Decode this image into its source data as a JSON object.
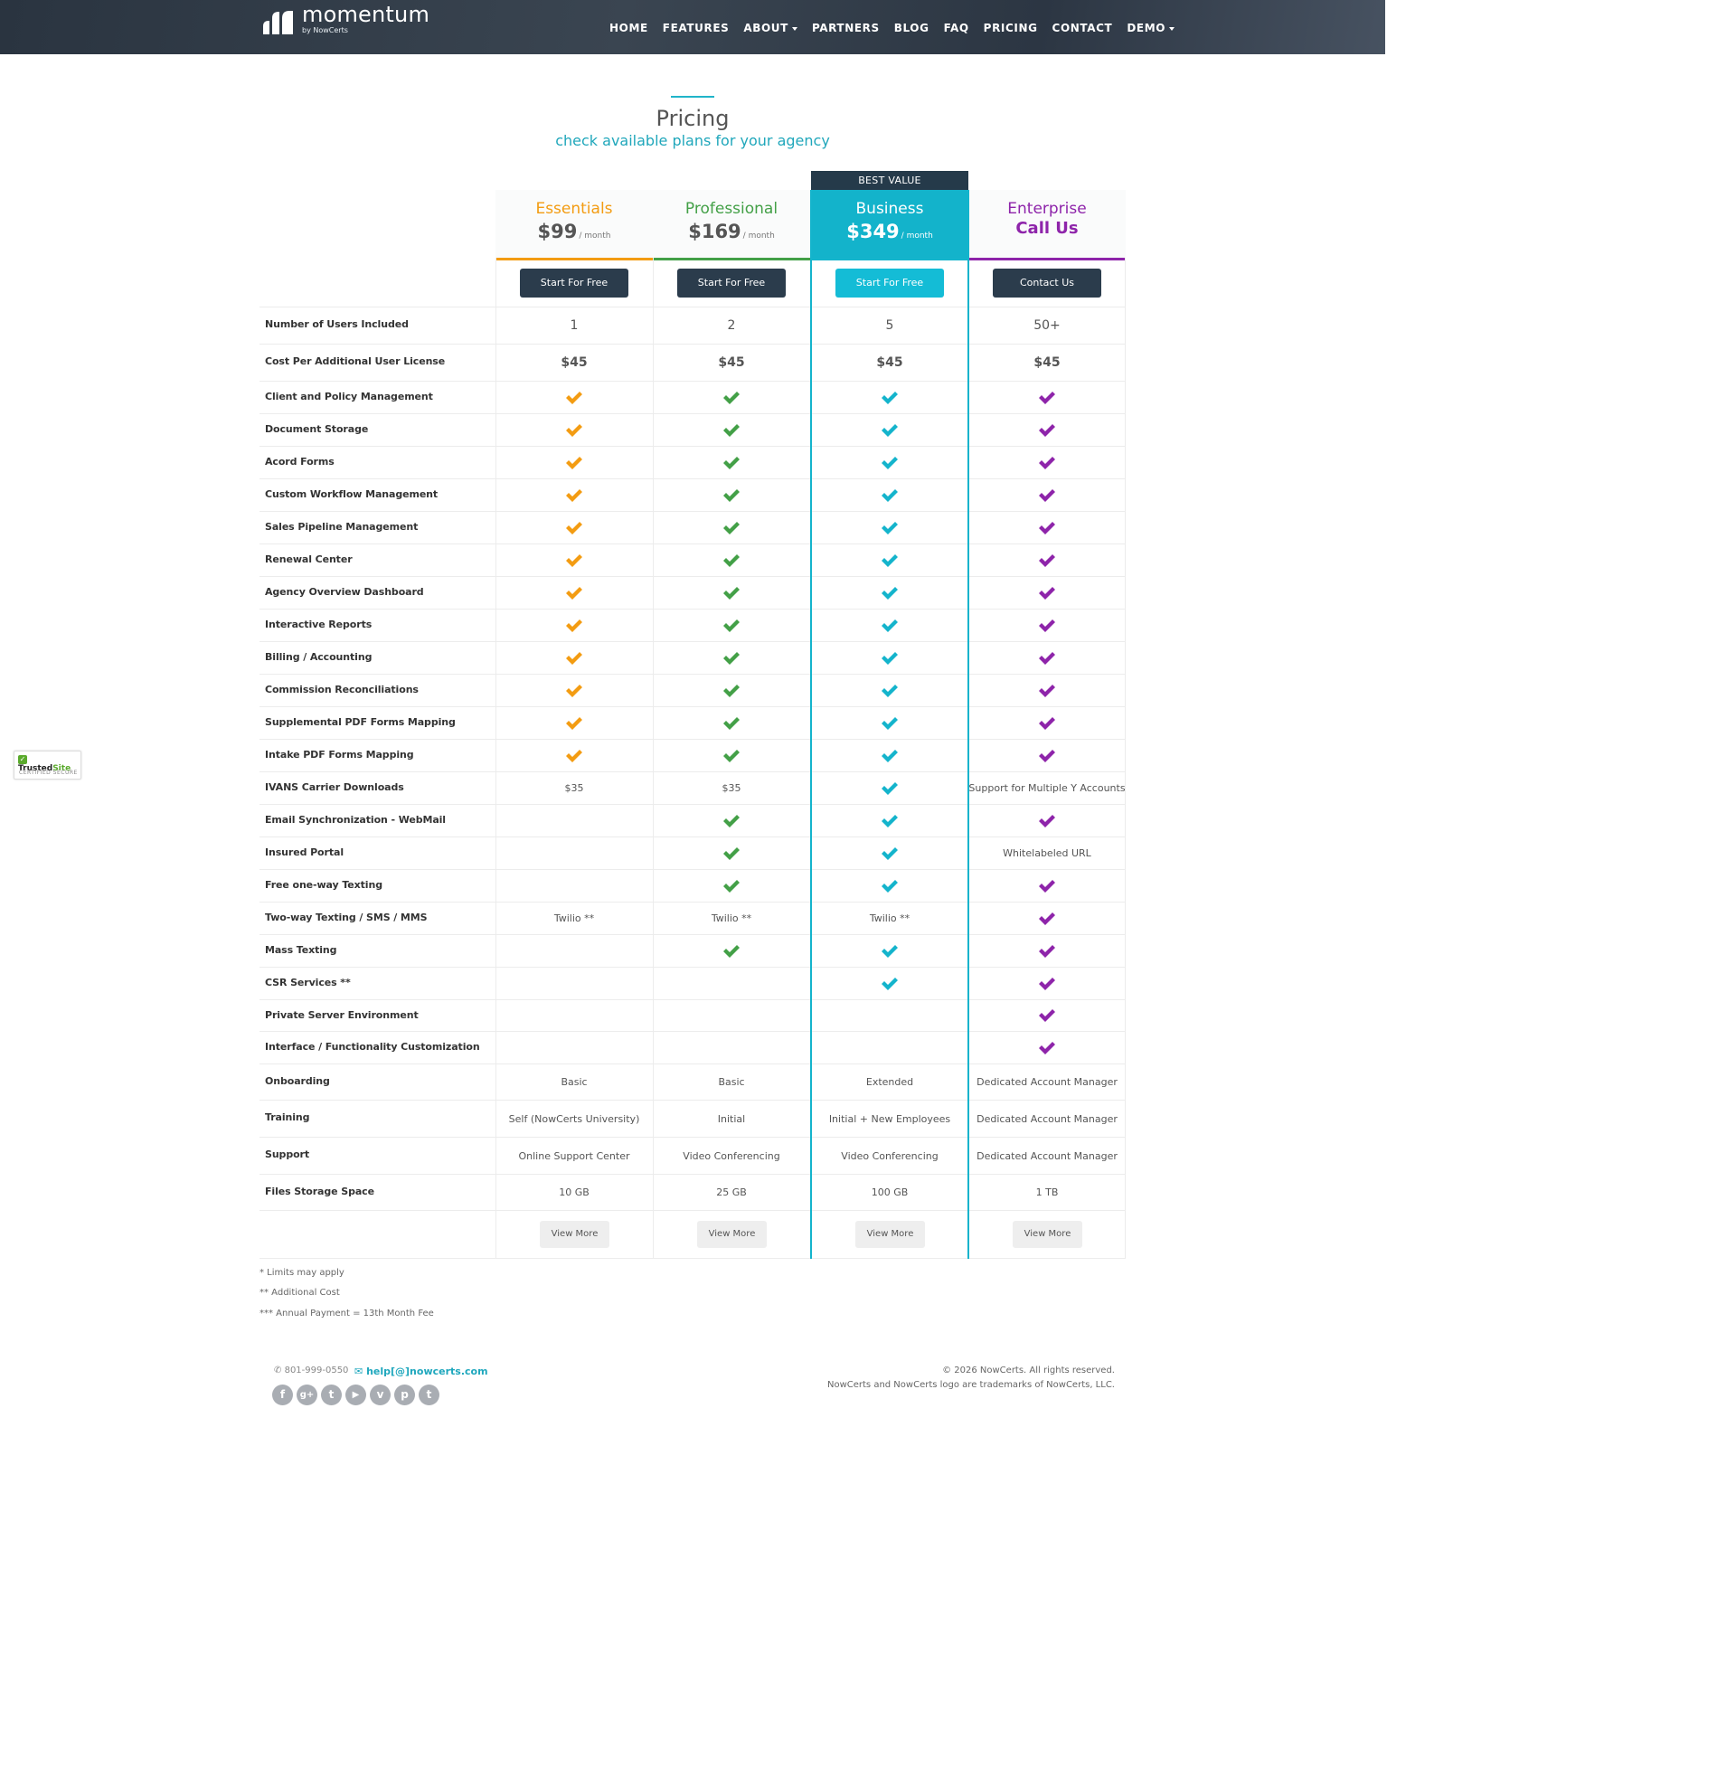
{
  "header": {
    "logo_text": "momentum",
    "logo_sub": "by NowCerts",
    "nav": [
      "HOME",
      "FEATURES",
      "ABOUT",
      "PARTNERS",
      "BLOG",
      "FAQ",
      "PRICING",
      "CONTACT",
      "DEMO"
    ]
  },
  "page": {
    "title": "Pricing",
    "subtitle": "check available plans for your agency"
  },
  "colors": {
    "essentials": "#f39c12",
    "professional": "#43a047",
    "business": "#14b4cc",
    "enterprise": "#8e24aa"
  },
  "plans": [
    {
      "name": "Essentials",
      "price": "$99",
      "per": "/ month",
      "button": "Start For Free"
    },
    {
      "name": "Professional",
      "price": "$169",
      "per": "/ month",
      "button": "Start For Free"
    },
    {
      "name": "Business",
      "price": "$349",
      "per": "/ month",
      "button": "Start For Free",
      "badge": "BEST VALUE"
    },
    {
      "name": "Enterprise",
      "price": "Call Us",
      "per": "",
      "button": "Contact Us"
    }
  ],
  "features": [
    {
      "label": "Number of Users Included",
      "values": [
        "1",
        "2",
        "5",
        "50+"
      ]
    },
    {
      "label": "Cost Per Additional User License",
      "values": [
        "$45",
        "$45",
        "$45",
        "$45"
      ]
    },
    {
      "label": "Client and Policy Management",
      "values": [
        "check",
        "check",
        "check",
        "check"
      ]
    },
    {
      "label": "Document Storage",
      "values": [
        "check",
        "check",
        "check",
        "check"
      ]
    },
    {
      "label": "Acord Forms",
      "values": [
        "check",
        "check",
        "check",
        "check"
      ]
    },
    {
      "label": "Custom Workflow Management",
      "values": [
        "check",
        "check",
        "check",
        "check"
      ]
    },
    {
      "label": "Sales Pipeline Management",
      "values": [
        "check",
        "check",
        "check",
        "check"
      ]
    },
    {
      "label": "Renewal Center",
      "values": [
        "check",
        "check",
        "check",
        "check"
      ]
    },
    {
      "label": "Agency Overview Dashboard",
      "values": [
        "check",
        "check",
        "check",
        "check"
      ]
    },
    {
      "label": "Interactive Reports",
      "values": [
        "check",
        "check",
        "check",
        "check"
      ]
    },
    {
      "label": "Billing / Accounting",
      "values": [
        "check",
        "check",
        "check",
        "check"
      ]
    },
    {
      "label": "Commission Reconciliations",
      "values": [
        "check",
        "check",
        "check",
        "check"
      ]
    },
    {
      "label": "Supplemental PDF Forms Mapping",
      "values": [
        "check",
        "check",
        "check",
        "check"
      ]
    },
    {
      "label": "Intake PDF Forms Mapping",
      "values": [
        "check",
        "check",
        "check",
        "check"
      ]
    },
    {
      "label": "IVANS Carrier Downloads",
      "values": [
        "$35",
        "$35",
        "check",
        "Support for Multiple Y Accounts"
      ]
    },
    {
      "label": "Email Synchronization - WebMail",
      "values": [
        "",
        "check",
        "check",
        "check"
      ]
    },
    {
      "label": "Insured Portal",
      "values": [
        "",
        "check",
        "check",
        "Whitelabeled URL"
      ]
    },
    {
      "label": "Free one-way Texting",
      "values": [
        "",
        "check",
        "check",
        "check"
      ]
    },
    {
      "label": "Two-way Texting / SMS / MMS",
      "values": [
        "Twilio **",
        "Twilio **",
        "Twilio **",
        "check"
      ]
    },
    {
      "label": "Mass Texting",
      "values": [
        "",
        "check",
        "check",
        "check"
      ]
    },
    {
      "label": "CSR Services **",
      "values": [
        "",
        "",
        "check",
        "check"
      ]
    },
    {
      "label": "Private Server Environment",
      "values": [
        "",
        "",
        "",
        "check"
      ]
    },
    {
      "label": "Interface / Functionality Customization",
      "values": [
        "",
        "",
        "",
        "check"
      ]
    },
    {
      "label": "Onboarding",
      "values": [
        "Basic",
        "Basic",
        "Extended",
        "Dedicated Account Manager"
      ]
    },
    {
      "label": "Training",
      "values": [
        "Self (NowCerts University)",
        "Initial",
        "Initial + New Employees",
        "Dedicated Account Manager"
      ]
    },
    {
      "label": "Support",
      "values": [
        "Online Support Center",
        "Video Conferencing",
        "Video Conferencing",
        "Dedicated Account Manager"
      ]
    },
    {
      "label": "Files Storage Space",
      "values": [
        "10 GB",
        "25 GB",
        "100 GB",
        "1 TB"
      ]
    }
  ],
  "view_more": "View More",
  "footnotes": [
    "* Limits may apply",
    "** Additional Cost",
    "*** Annual Payment = 13th Month Fee"
  ],
  "trusted": {
    "title_a": "Trusted",
    "title_b": "Site",
    "sub": "CERTIFIED SECURE"
  },
  "footer": {
    "phone": "801-999-0550",
    "email": "help[@]nowcerts.com",
    "copyright": "© 2026 NowCerts. All rights reserved.",
    "trademark": "NowCerts and NowCerts logo are trademarks of NowCerts, LLC.",
    "social": [
      "facebook-icon",
      "google-plus-icon",
      "twitter-icon",
      "youtube-icon",
      "vimeo-icon",
      "pinterest-icon",
      "tumblr-icon"
    ]
  }
}
